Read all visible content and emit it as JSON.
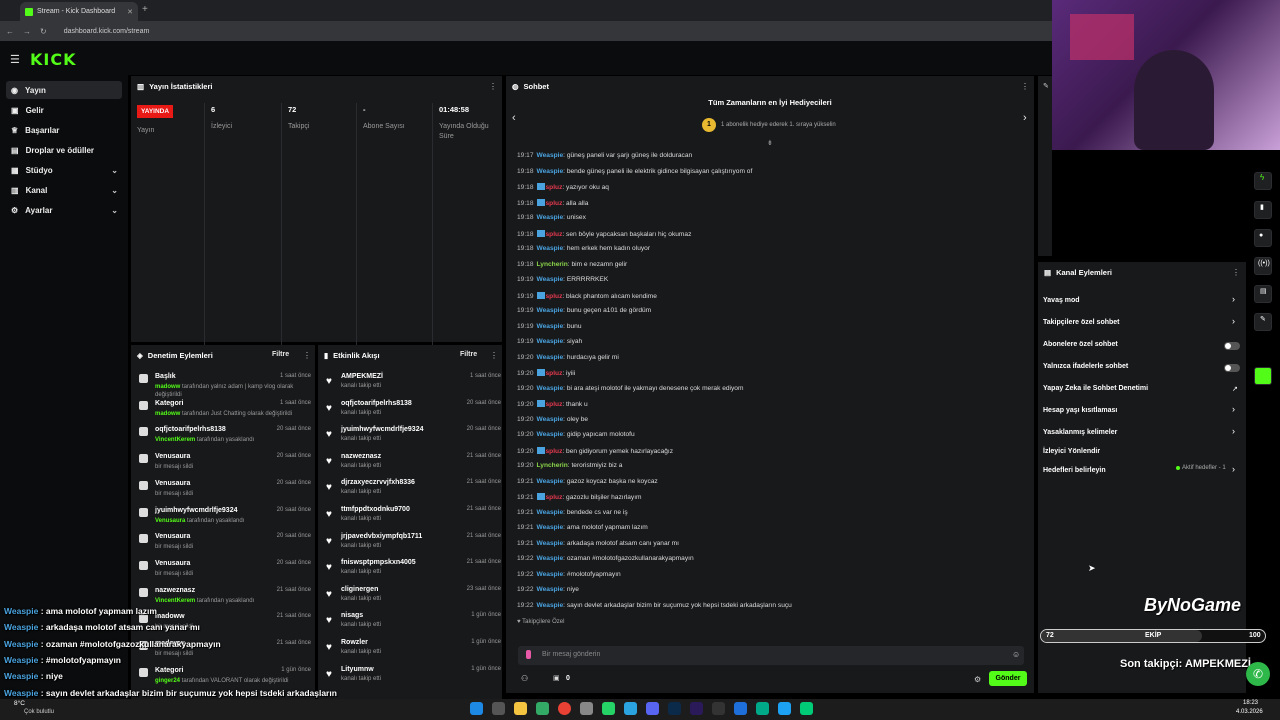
{
  "browser": {
    "tab_title": "Stream - Kick Dashboard",
    "url": "dashboard.kick.com/stream"
  },
  "logo": "KICK",
  "sidebar": {
    "items": [
      {
        "label": "Yayın",
        "icon": "broadcast-icon"
      },
      {
        "label": "Gelir",
        "icon": "wallet-icon"
      },
      {
        "label": "Başarılar",
        "icon": "trophy-icon"
      },
      {
        "label": "Droplar ve ödüller",
        "icon": "gift-icon"
      },
      {
        "label": "Stüdyo",
        "icon": "studio-icon"
      },
      {
        "label": "Kanal",
        "icon": "channel-icon"
      },
      {
        "label": "Ayarlar",
        "icon": "gear-icon"
      }
    ]
  },
  "stats": {
    "title": "Yayın İstatistikleri",
    "live_badge": "YAYINDA",
    "live_label": "Yayın",
    "viewers": "6",
    "viewers_label": "İzleyici",
    "followers": "72",
    "followers_label": "Takipçi",
    "subs": "-",
    "subs_label": "Abone Sayısı",
    "uptime": "01:48:58",
    "uptime_label": "Yayında Olduğu Süre"
  },
  "mod": {
    "title": "Denetim Eylemleri",
    "filter": "Filtre",
    "items": [
      {
        "title": "Başlık",
        "user": "madoww",
        "desc": " tarafından yalnız adam | kamp vlog olarak değiştirildi",
        "time": "1 saat önce"
      },
      {
        "title": "Kategori",
        "user": "madoww",
        "desc": " tarafından Just Chatting olarak değiştirildi",
        "time": "1 saat önce"
      },
      {
        "title": "oqfjctoarifpelrhs8138",
        "user": "VincentKerem",
        "desc": " tarafından yasaklandı",
        "time": "20 saat önce"
      },
      {
        "title": "Venusaura",
        "user": "",
        "desc": "bir mesajı sildi",
        "time": "20 saat önce"
      },
      {
        "title": "Venusaura",
        "user": "",
        "desc": "bir mesajı sildi",
        "time": "20 saat önce"
      },
      {
        "title": "jyuimhwyfwcmdrlfje9324",
        "user": "Venusaura",
        "desc": " tarafından yasaklandı",
        "time": "20 saat önce"
      },
      {
        "title": "Venusaura",
        "user": "",
        "desc": "bir mesajı sildi",
        "time": "20 saat önce"
      },
      {
        "title": "Venusaura",
        "user": "",
        "desc": "bir mesajı sildi",
        "time": "20 saat önce"
      },
      {
        "title": "nazweznasz",
        "user": "VincentKerem",
        "desc": " tarafından yasaklandı",
        "time": "21 saat önce"
      },
      {
        "title": "madoww",
        "user": "",
        "desc": "bir mesajı sildi",
        "time": "21 saat önce"
      },
      {
        "title": "madoww",
        "user": "",
        "desc": "bir mesajı sildi",
        "time": "21 saat önce"
      },
      {
        "title": "Kategori",
        "user": "ginger24",
        "desc": " tarafından VALORANT olarak değiştirildi",
        "time": "1 gün önce"
      }
    ]
  },
  "activity": {
    "title": "Etkinlik Akışı",
    "filter": "Filtre",
    "items": [
      {
        "name": "AMPEKMEZİ",
        "desc": "kanalı takip etti",
        "time": "1 saat önce"
      },
      {
        "name": "oqfjctoarifpelrhs8138",
        "desc": "kanalı takip etti",
        "time": "20 saat önce"
      },
      {
        "name": "jyuimhwyfwcmdrlfje9324",
        "desc": "kanalı takip etti",
        "time": "20 saat önce"
      },
      {
        "name": "nazweznasz",
        "desc": "kanalı takip etti",
        "time": "21 saat önce"
      },
      {
        "name": "djrzaxyeczrvvjfxh8336",
        "desc": "kanalı takip etti",
        "time": "21 saat önce"
      },
      {
        "name": "ttmfppdtxodnku9700",
        "desc": "kanalı takip etti",
        "time": "21 saat önce"
      },
      {
        "name": "jrjpavedvbxiympfqb1711",
        "desc": "kanalı takip etti",
        "time": "21 saat önce"
      },
      {
        "name": "fniswsptpmpskxn4005",
        "desc": "kanalı takip etti",
        "time": "21 saat önce"
      },
      {
        "name": "cliginergen",
        "desc": "kanalı takip etti",
        "time": "23 saat önce"
      },
      {
        "name": "nisags",
        "desc": "kanalı takip etti",
        "time": "1 gün önce"
      },
      {
        "name": "Rowzler",
        "desc": "kanalı takip etti",
        "time": "1 gün önce"
      },
      {
        "name": "Lityumnw",
        "desc": "kanalı takip etti",
        "time": "1 gün önce"
      }
    ]
  },
  "chat": {
    "title": "Sohbet",
    "gifters_title": "Tüm Zamanların en İyi Hediyecileri",
    "gifters_sub": "1 abonelik hediye ederek 1. sıraya yükselin",
    "gifters_rank": "1",
    "messages": [
      {
        "t": "19:17",
        "u": "Weaspie",
        "c": "#4aa3df",
        "m": ": güneş paneli var şarjı güneş ile dolduracan",
        "b": false
      },
      {
        "t": "19:18",
        "u": "Weaspie",
        "c": "#4aa3df",
        "m": ": bende güneş paneli ile elektrik gidince bilgisayan çalıştırıyom of",
        "b": false
      },
      {
        "t": "19:18",
        "u": "spluz",
        "c": "#e5394f",
        "m": ": yazıyor oku aq",
        "b": true
      },
      {
        "t": "19:18",
        "u": "spluz",
        "c": "#e5394f",
        "m": ": alla alla",
        "b": true
      },
      {
        "t": "19:18",
        "u": "Weaspie",
        "c": "#4aa3df",
        "m": ": unisex",
        "b": false
      },
      {
        "t": "19:18",
        "u": "spluz",
        "c": "#e5394f",
        "m": ": sen böyle yapcaksan başkaları hiç okumaz",
        "b": true
      },
      {
        "t": "19:18",
        "u": "Weaspie",
        "c": "#4aa3df",
        "m": ": hem erkek hem kadın oluyor",
        "b": false
      },
      {
        "t": "19:18",
        "u": "Lyncherin",
        "c": "#8ad44a",
        "m": ": bim e nezamn gelir",
        "b": false
      },
      {
        "t": "19:19",
        "u": "Weaspie",
        "c": "#4aa3df",
        "m": ": ERRRRRKEK",
        "b": false
      },
      {
        "t": "19:19",
        "u": "spluz",
        "c": "#e5394f",
        "m": ": black phantom alıcam kendime",
        "b": true
      },
      {
        "t": "19:19",
        "u": "Weaspie",
        "c": "#4aa3df",
        "m": ": bunu geçen a101 de gördüm",
        "b": false
      },
      {
        "t": "19:19",
        "u": "Weaspie",
        "c": "#4aa3df",
        "m": ": bunu",
        "b": false
      },
      {
        "t": "19:19",
        "u": "Weaspie",
        "c": "#4aa3df",
        "m": ": siyah",
        "b": false
      },
      {
        "t": "19:20",
        "u": "Weaspie",
        "c": "#4aa3df",
        "m": ": hurdacıya gelir mi",
        "b": false
      },
      {
        "t": "19:20",
        "u": "spluz",
        "c": "#e5394f",
        "m": ": iyiii",
        "b": true
      },
      {
        "t": "19:20",
        "u": "Weaspie",
        "c": "#4aa3df",
        "m": ": bi ara ateşi molotof ile yakmayı denesene çok merak ediyom",
        "b": false
      },
      {
        "t": "19:20",
        "u": "spluz",
        "c": "#e5394f",
        "m": ": thank u",
        "b": true
      },
      {
        "t": "19:20",
        "u": "Weaspie",
        "c": "#4aa3df",
        "m": ": oley be",
        "b": false
      },
      {
        "t": "19:20",
        "u": "Weaspie",
        "c": "#4aa3df",
        "m": ": gidip yapıcam molotofu",
        "b": false
      },
      {
        "t": "19:20",
        "u": "spluz",
        "c": "#e5394f",
        "m": ": ben gidiyorum yemek hazırlayacağız",
        "b": true
      },
      {
        "t": "19:20",
        "u": "Lyncherin",
        "c": "#8ad44a",
        "m": ": teroristmiyiz biz a",
        "b": false
      },
      {
        "t": "19:21",
        "u": "Weaspie",
        "c": "#4aa3df",
        "m": ": gazoz koycaz başka ne koycaz",
        "b": false
      },
      {
        "t": "19:21",
        "u": "spluz",
        "c": "#e5394f",
        "m": ": gazozlu bilşiler hazırlayım",
        "b": true
      },
      {
        "t": "19:21",
        "u": "Weaspie",
        "c": "#4aa3df",
        "m": ": bendede cs var ne iş",
        "b": false
      },
      {
        "t": "19:21",
        "u": "Weaspie",
        "c": "#4aa3df",
        "m": ": ama molotof yapmam lazım",
        "b": false
      },
      {
        "t": "19:21",
        "u": "Weaspie",
        "c": "#4aa3df",
        "m": ": arkadaşa molotof atsam canı yanar mı",
        "b": false
      },
      {
        "t": "19:22",
        "u": "Weaspie",
        "c": "#4aa3df",
        "m": ": ozaman #molotofgazozkullanarakyapmayın",
        "b": false
      },
      {
        "t": "19:22",
        "u": "Weaspie",
        "c": "#4aa3df",
        "m": ": #molotofyapmayın",
        "b": false
      },
      {
        "t": "19:22",
        "u": "Weaspie",
        "c": "#4aa3df",
        "m": ": niye",
        "b": false
      },
      {
        "t": "19:22",
        "u": "Weaspie",
        "c": "#4aa3df",
        "m": ": sayın devlet arkadaşlar bizim bir suçumuz yok hepsi tsdeki arkadaşların suçu",
        "b": false
      }
    ],
    "followers_only": "Takipçilere Özel",
    "placeholder": "Bir mesaj gönderin",
    "points": "0",
    "send": "Gönder"
  },
  "channel_actions": {
    "title": "Kanal Eylemleri",
    "items": [
      {
        "label": "Yavaş mod",
        "type": "chevron"
      },
      {
        "label": "Takipçilere özel sohbet",
        "type": "chevron"
      },
      {
        "label": "Abonelere özel sohbet",
        "type": "toggle"
      },
      {
        "label": "Yalnızca ifadelerle sohbet",
        "type": "toggle"
      },
      {
        "label": "Yapay Zeka ile Sohbet Denetimi",
        "type": "external"
      },
      {
        "label": "Hesap yaşı kısıtlaması",
        "type": "chevron"
      },
      {
        "label": "Yasaklanmış kelimeler",
        "type": "chevron"
      },
      {
        "label": "İzleyici Yönlendir",
        "type": "none"
      },
      {
        "label": "Hedefleri belirleyin",
        "type": "chevron"
      }
    ],
    "goals_status": "Aktif hedefler - 1"
  },
  "overlay": {
    "brand": "ByNoGame",
    "goal_current": "72",
    "goal_label": "EKİP",
    "goal_target": "100",
    "last_follower": "Son takipçi: AMPEKMEZİ",
    "chat": [
      {
        "u": "Weaspie",
        "m": " : ama molotof yapmam lazım"
      },
      {
        "u": "Weaspie",
        "m": " : arkadaşa molotof atsam canı yanar mı"
      },
      {
        "u": "Weaspie",
        "m": " : ozaman #molotofgazozkullanarakyapmayın"
      },
      {
        "u": "Weaspie",
        "m": " : #molotofyapmayın"
      },
      {
        "u": "Weaspie",
        "m": " : niye"
      },
      {
        "u": "Weaspie",
        "m": " : sayın devlet arkadaşlar bizim bir suçumuz yok hepsi tsdeki arkadaşların"
      }
    ]
  },
  "taskbar": {
    "weather_temp": "8°C",
    "weather": "Çok bulutlu",
    "time": "18:23",
    "date": "4.03.2026"
  },
  "colors": {
    "kick_green": "#53fc18",
    "live_red": "#e91916",
    "panel": "#18191b"
  }
}
